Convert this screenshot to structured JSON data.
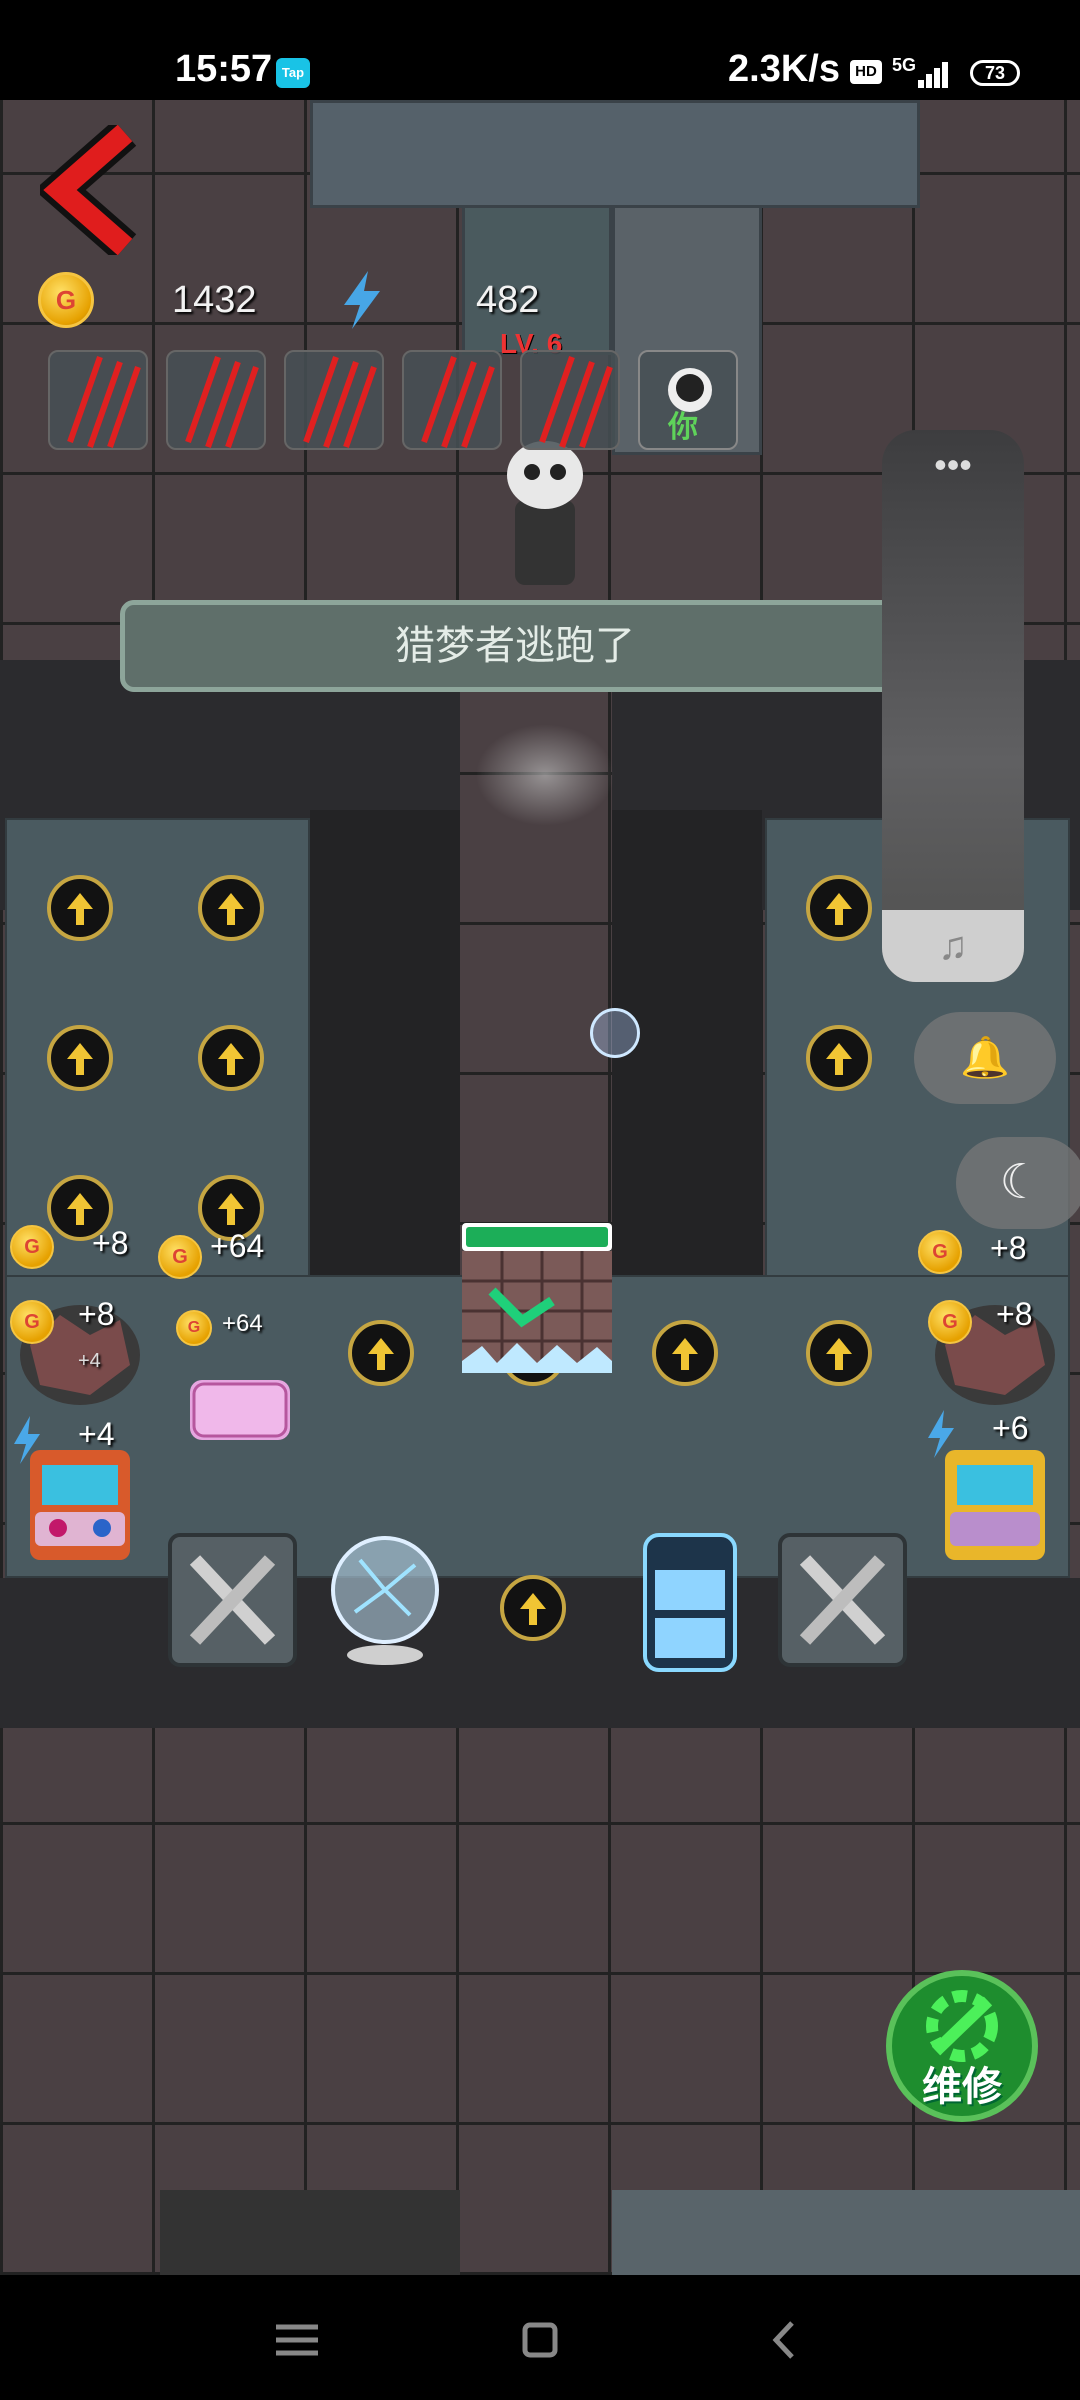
{
  "status_bar": {
    "time": "15:57",
    "tap_badge": "Tap",
    "net_speed": "2.3K/s",
    "hd": "HD",
    "network": "5G",
    "battery": "73"
  },
  "hud": {
    "coins": "1432",
    "energy": "482",
    "level": "LV. 6",
    "you_label": "你"
  },
  "toast": {
    "message": "猎梦者逃跑了"
  },
  "side_panel": {
    "dots": "•••",
    "music": "♫",
    "bell": "🔔",
    "moon": "☾"
  },
  "badges": {
    "left_coin_partial": "+8",
    "bed_bonus": "+64",
    "bed_bonus_small": "+64",
    "left_rock": "+8",
    "left_rock_small": "+4",
    "left_arcade": "+4",
    "right_coin_partial": "+8",
    "right_rock": "+8",
    "right_arcade": "+6"
  },
  "repair_button": {
    "label": "维修"
  },
  "colors": {
    "accent": "#f0c534",
    "repair_green": "#1e8d2e",
    "level_red": "#ee3333"
  }
}
